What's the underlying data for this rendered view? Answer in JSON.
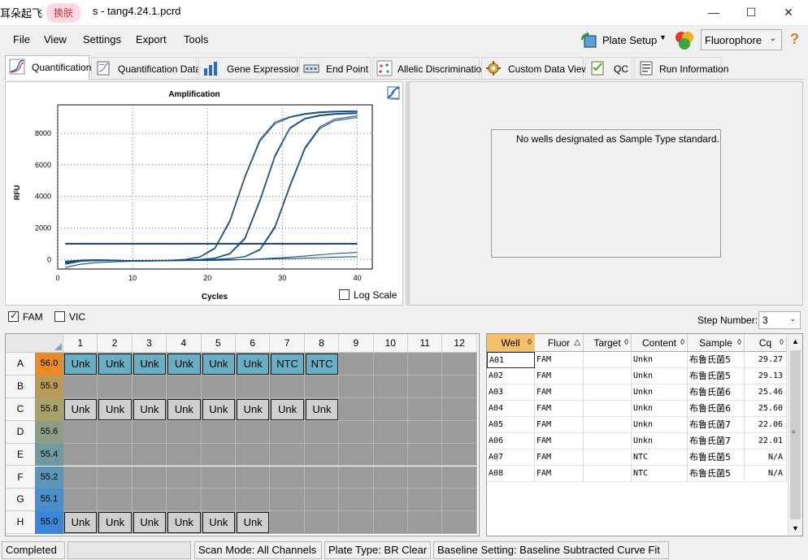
{
  "window": {
    "ime_text": "耳朵起飞",
    "skin_button": "换肤",
    "title": "s - tang4.24.1.pcrd",
    "controls": [
      "—",
      "☐",
      "✕"
    ]
  },
  "menu": {
    "file": "File",
    "view": "View",
    "settings": "Settings",
    "export": "Export",
    "tools": "Tools"
  },
  "toolbar": {
    "plate_setup": "Plate Setup",
    "fluorophore": "Fluorophore",
    "help": "?"
  },
  "tabs": [
    {
      "label": "Quantification",
      "active": true
    },
    {
      "label": "Quantification Data"
    },
    {
      "label": "Gene Expression"
    },
    {
      "label": "End Point"
    },
    {
      "label": "Allelic Discrimination"
    },
    {
      "label": "Custom Data View"
    },
    {
      "label": "QC"
    },
    {
      "label": "Run Information"
    }
  ],
  "chart": {
    "log_scale_label": "Log Scale",
    "log_scale_checked": false
  },
  "chart_data": {
    "type": "line",
    "title": "Amplification",
    "xlabel": "Cycles",
    "ylabel": "RFU",
    "xlim": [
      0,
      42
    ],
    "ylim": [
      -600,
      9800
    ],
    "xticks": [
      0,
      10,
      20,
      30,
      40
    ],
    "yticks": [
      0,
      2000,
      4000,
      6000,
      8000
    ],
    "grid": true,
    "threshold": 1000,
    "x": [
      1,
      3,
      5,
      7,
      9,
      11,
      13,
      15,
      17,
      19,
      21,
      23,
      25,
      27,
      29,
      31,
      33,
      35,
      37,
      40
    ],
    "series": [
      {
        "values": [
          -150,
          -50,
          -20,
          -40,
          -80,
          -100,
          -90,
          -60,
          0,
          150,
          700,
          2400,
          5200,
          7500,
          8600,
          9000,
          9200,
          9300,
          9350,
          9380
        ]
      },
      {
        "values": [
          -100,
          -40,
          -10,
          -30,
          -60,
          -80,
          -80,
          -50,
          20,
          180,
          750,
          2500,
          5300,
          7600,
          8700,
          9050,
          9250,
          9350,
          9400,
          9420
        ]
      },
      {
        "values": [
          -300,
          -120,
          -60,
          -60,
          -80,
          -90,
          -80,
          -60,
          -30,
          0,
          80,
          350,
          1300,
          3700,
          6500,
          8300,
          8900,
          9100,
          9200,
          9250
        ]
      },
      {
        "values": [
          -250,
          -100,
          -50,
          -50,
          -70,
          -80,
          -70,
          -50,
          -20,
          10,
          100,
          400,
          1400,
          3800,
          6600,
          8350,
          8950,
          9150,
          9250,
          9300
        ]
      },
      {
        "values": [
          -200,
          -80,
          -40,
          -50,
          -70,
          -80,
          -80,
          -70,
          -50,
          -30,
          0,
          60,
          180,
          600,
          2000,
          4600,
          7000,
          8300,
          8800,
          9000
        ]
      },
      {
        "values": [
          -180,
          -70,
          -30,
          -40,
          -60,
          -70,
          -70,
          -60,
          -40,
          -20,
          10,
          70,
          200,
          650,
          2100,
          4700,
          7100,
          8400,
          8900,
          9100
        ]
      },
      {
        "values": [
          -500,
          -300,
          -200,
          -150,
          -120,
          -100,
          -90,
          -80,
          -70,
          -60,
          -50,
          -30,
          0,
          40,
          90,
          150,
          220,
          300,
          380,
          450
        ]
      },
      {
        "values": [
          -100,
          -90,
          -80,
          -70,
          -60,
          -60,
          -55,
          -50,
          -40,
          -30,
          -20,
          -10,
          0,
          20,
          40,
          60,
          90,
          120,
          150,
          180
        ]
      }
    ]
  },
  "standard_panel": {
    "message": "No wells designated as Sample Type standard."
  },
  "fluors": [
    {
      "label": "FAM",
      "checked": true
    },
    {
      "label": "VIC",
      "checked": false
    }
  ],
  "step": {
    "label": "Step Number:",
    "value": "3"
  },
  "plate": {
    "columns": [
      "1",
      "2",
      "3",
      "4",
      "5",
      "6",
      "7",
      "8",
      "9",
      "10",
      "11",
      "12"
    ],
    "rows": [
      {
        "label": "A",
        "temp": "56.0",
        "temp_color": "#e8892a",
        "wells": [
          "Unk",
          "Unk",
          "Unk",
          "Unk",
          "Unk",
          "Unk",
          "NTC",
          "NTC"
        ],
        "selected": true
      },
      {
        "label": "B",
        "temp": "55.9",
        "temp_color": "#b99a59",
        "wells": []
      },
      {
        "label": "C",
        "temp": "55.8",
        "temp_color": "#a8a16a",
        "wells": [
          "Unk",
          "Unk",
          "Unk",
          "Unk",
          "Unk",
          "Unk",
          "Unk",
          "Unk"
        ],
        "selected": false
      },
      {
        "label": "D",
        "temp": "55.6",
        "temp_color": "#8c9f86",
        "wells": []
      },
      {
        "label": "E",
        "temp": "55.4",
        "temp_color": "#6f9aa0",
        "wells": []
      },
      {
        "label": "F",
        "temp": "55.2",
        "temp_color": "#5b95ba",
        "wells": []
      },
      {
        "label": "G",
        "temp": "55.1",
        "temp_color": "#4c8ecc",
        "wells": []
      },
      {
        "label": "H",
        "temp": "55.0",
        "temp_color": "#3b86da",
        "wells": [
          "Unk",
          "Unk",
          "Unk",
          "Unk",
          "Unk",
          "Unk"
        ],
        "selected": false
      }
    ]
  },
  "table": {
    "headers": [
      "Well",
      "Fluor",
      "Target",
      "Content",
      "Sample",
      "Cq"
    ],
    "sort_marks": [
      "◊",
      "△",
      "◊",
      "◊",
      "◊",
      "◊"
    ],
    "rows": [
      [
        "A01",
        "FAM",
        "",
        "Unkn",
        "布鲁氏菌5",
        "29.27"
      ],
      [
        "A02",
        "FAM",
        "",
        "Unkn",
        "布鲁氏菌5",
        "29.13"
      ],
      [
        "A03",
        "FAM",
        "",
        "Unkn",
        "布鲁氏菌6",
        "25.46"
      ],
      [
        "A04",
        "FAM",
        "",
        "Unkn",
        "布鲁氏菌6",
        "25.60"
      ],
      [
        "A05",
        "FAM",
        "",
        "Unkn",
        "布鲁氏菌7",
        "22.06"
      ],
      [
        "A06",
        "FAM",
        "",
        "Unkn",
        "布鲁氏菌7",
        "22.01"
      ],
      [
        "A07",
        "FAM",
        "",
        "NTC",
        "布鲁氏菌5",
        "N/A"
      ],
      [
        "A08",
        "FAM",
        "",
        "NTC",
        "布鲁氏菌5",
        "N/A"
      ]
    ]
  },
  "status": {
    "completed": "Completed",
    "scan_mode": "Scan Mode: All Channels",
    "plate_type": "Plate Type: BR Clear",
    "baseline": "Baseline Setting: Baseline Subtracted Curve Fit"
  }
}
